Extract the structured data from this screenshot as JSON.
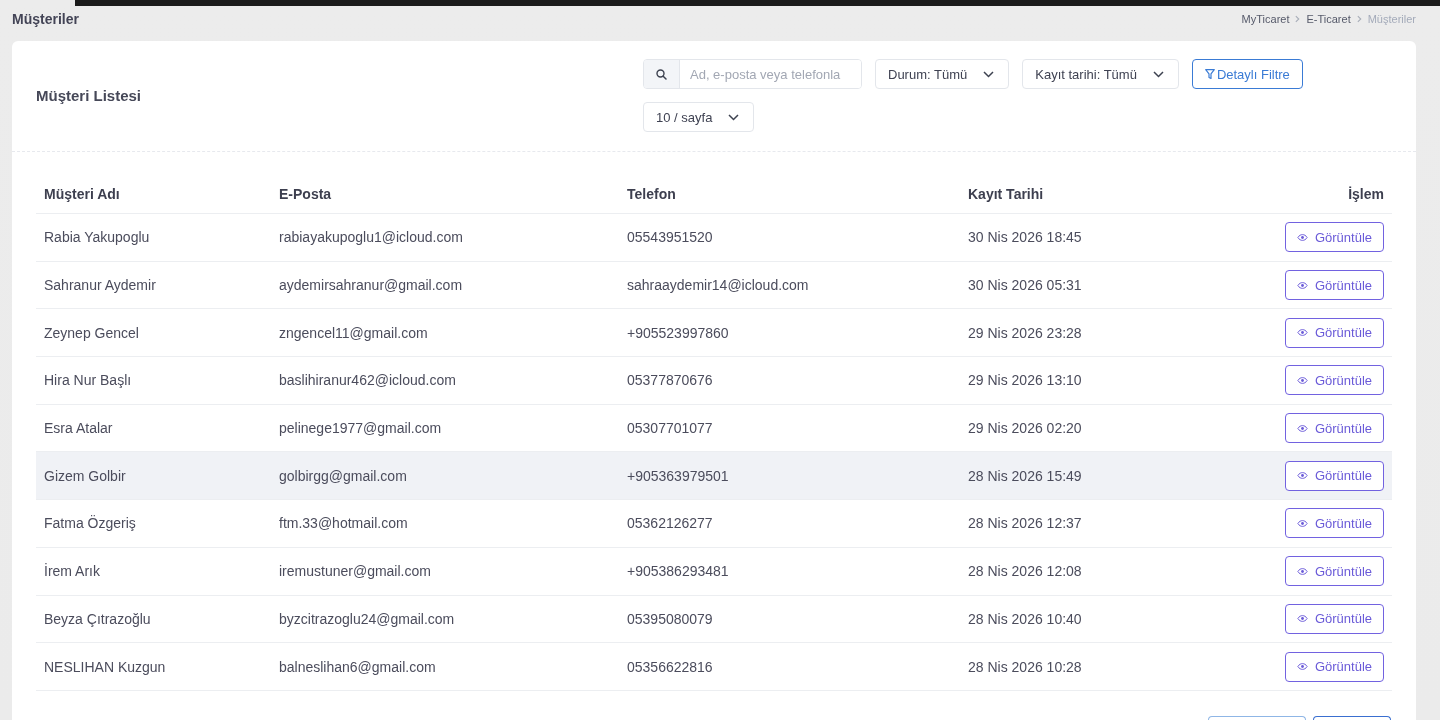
{
  "page": {
    "title": "Müşteriler",
    "breadcrumb": [
      {
        "label": "MyTicaret",
        "current": false
      },
      {
        "label": "E-Ticaret",
        "current": false
      },
      {
        "label": "Müşteriler",
        "current": true
      }
    ]
  },
  "card": {
    "title": "Müşteri Listesi",
    "toolbar": [
      {
        "kind": "search",
        "placeholder": "Ad, e-posta veya telefonla"
      },
      {
        "kind": "select",
        "label": "Durum: Tümü"
      },
      {
        "kind": "select",
        "label": "Kayıt tarihi: Tümü"
      },
      {
        "kind": "filter_button",
        "label": "Detaylı Filtre"
      },
      {
        "kind": "select",
        "label": "10 / sayfa"
      }
    ]
  },
  "table": {
    "columns": [
      "Müşteri Adı",
      "E-Posta",
      "Telefon",
      "Kayıt Tarihi",
      "İşlem"
    ],
    "rows": [
      {
        "name": "Rabia Yakupoglu",
        "email": "rabiayakupoglu1@icloud.com",
        "phone": "05543951520",
        "registered": "30 Nis 2026 18:45",
        "action": "Görüntüle",
        "hovered": false
      },
      {
        "name": "Sahranur Aydemir",
        "email": "aydemirsahranur@gmail.com",
        "phone": "sahraaydemir14@icloud.com",
        "registered": "30 Nis 2026 05:31",
        "action": "Görüntüle",
        "hovered": false
      },
      {
        "name": "Zeynep Gencel",
        "email": "zngencel11@gmail.com",
        "phone": "+905523997860",
        "registered": "29 Nis 2026 23:28",
        "action": "Görüntüle",
        "hovered": false
      },
      {
        "name": "Hira Nur Başlı",
        "email": "baslihiranur462@icloud.com",
        "phone": "05377870676",
        "registered": "29 Nis 2026 13:10",
        "action": "Görüntüle",
        "hovered": false
      },
      {
        "name": "Esra Atalar",
        "email": "pelinege1977@gmail.com",
        "phone": "05307701077",
        "registered": "29 Nis 2026 02:20",
        "action": "Görüntüle",
        "hovered": false
      },
      {
        "name": "Gizem Golbir",
        "email": "golbirgg@gmail.com",
        "phone": "+905363979501",
        "registered": "28 Nis 2026 15:49",
        "action": "Görüntüle",
        "hovered": true
      },
      {
        "name": "Fatma Özgeriş",
        "email": "ftm.33@hotmail.com",
        "phone": "05362126277",
        "registered": "28 Nis 2026 12:37",
        "action": "Görüntüle",
        "hovered": false
      },
      {
        "name": "İrem Arık",
        "email": "iremustuner@gmail.com",
        "phone": "+905386293481",
        "registered": "28 Nis 2026 12:08",
        "action": "Görüntüle",
        "hovered": false
      },
      {
        "name": "Beyza Çıtrazoğlu",
        "email": "byzcitrazoglu24@gmail.com",
        "phone": "05395080079",
        "registered": "28 Nis 2026 10:40",
        "action": "Görüntüle",
        "hovered": false
      },
      {
        "name": "NESLIHAN Kuzgun",
        "email": "balneslihan6@gmail.com",
        "phone": "05356622816",
        "registered": "28 Nis 2026 10:28",
        "action": "Görüntüle",
        "hovered": false
      }
    ]
  },
  "pagination": [
    {
      "kind": "secondary"
    },
    {
      "kind": "primary"
    }
  ]
}
